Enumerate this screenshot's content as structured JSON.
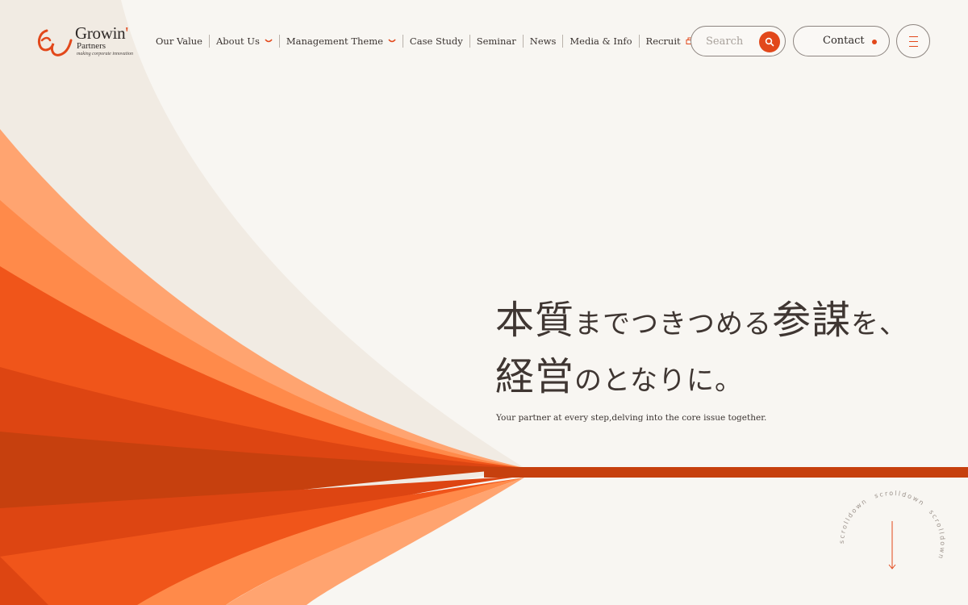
{
  "brand": {
    "name": "Growin",
    "apostrophe": "'",
    "sub": "Partners",
    "tagline": "making corporate innovation",
    "accent_color": "#e2481b"
  },
  "nav": {
    "items": [
      {
        "label": "Our Value"
      },
      {
        "label": "About Us",
        "icon": "chevron-down-icon"
      },
      {
        "label": "Management Theme",
        "icon": "chevron-down-icon"
      },
      {
        "label": "Case Study"
      },
      {
        "label": "Seminar"
      },
      {
        "label": "News"
      },
      {
        "label": "Media & Info"
      },
      {
        "label": "Recruit",
        "icon": "external-link-icon"
      }
    ]
  },
  "search": {
    "placeholder": "Search",
    "icon": "search-icon"
  },
  "contact": {
    "label": "Contact"
  },
  "menu": {
    "icon": "hamburger-menu-icon"
  },
  "hero": {
    "line1": {
      "a": "本質",
      "b": "までつきつめる",
      "c": "参謀",
      "d": "を、"
    },
    "line2": {
      "a": "経営",
      "b": "のとなりに。"
    },
    "subtitle": "Your partner at every step,delving into the core issue together."
  },
  "scroll": {
    "text": "scrolldown　scrolldown　scrolldown　",
    "icon": "arrow-down-icon"
  }
}
